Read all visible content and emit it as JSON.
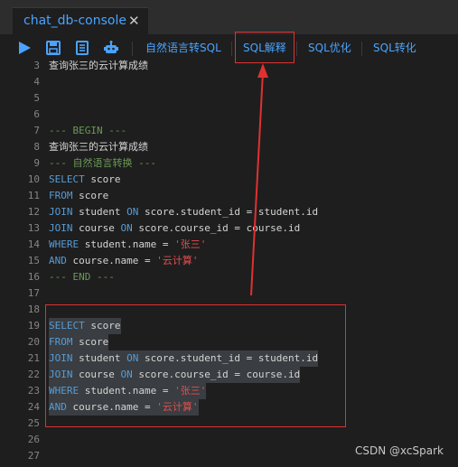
{
  "tab": {
    "title": "chat_db-console",
    "close": "✕"
  },
  "toolbar": {
    "nl_to_sql": "自然语言转SQL",
    "sql_explain": "SQL解释",
    "sql_optimize": "SQL优化",
    "sql_convert": "SQL转化"
  },
  "editor": {
    "lines": [
      {
        "n": "3",
        "t": "查询张三的云计算成绩"
      },
      {
        "n": "4",
        "t": ""
      },
      {
        "n": "5",
        "t": ""
      },
      {
        "n": "6",
        "t": ""
      },
      {
        "n": "7",
        "t": "--- BEGIN ---"
      },
      {
        "n": "8",
        "t": "查询张三的云计算成绩"
      },
      {
        "n": "9",
        "t": "--- 自然语言转换 ---"
      },
      {
        "n": "10",
        "t": "SELECT score"
      },
      {
        "n": "11",
        "t": "FROM score"
      },
      {
        "n": "12",
        "t": "JOIN student ON score.student_id = student.id"
      },
      {
        "n": "13",
        "t": "JOIN course ON score.course_id = course.id"
      },
      {
        "n": "14",
        "t": "WHERE student.name = '张三'"
      },
      {
        "n": "15",
        "t": "AND course.name = '云计算'"
      },
      {
        "n": "16",
        "t": "--- END ---"
      },
      {
        "n": "17",
        "t": ""
      },
      {
        "n": "18",
        "t": ""
      },
      {
        "n": "19",
        "t": "SELECT score"
      },
      {
        "n": "20",
        "t": "FROM score"
      },
      {
        "n": "21",
        "t": "JOIN student ON score.student_id = student.id"
      },
      {
        "n": "22",
        "t": "JOIN course ON score.course_id = course.id"
      },
      {
        "n": "23",
        "t": "WHERE student.name = '张三'"
      },
      {
        "n": "24",
        "t": "AND course.name = '云计算'"
      },
      {
        "n": "25",
        "t": ""
      },
      {
        "n": "26",
        "t": ""
      },
      {
        "n": "27",
        "t": ""
      }
    ]
  },
  "watermark": "CSDN @xcSpark",
  "colors": {
    "accent": "#4aa3ff",
    "highlight": "#e03131",
    "keyword": "#569cd6",
    "string": "#e05050",
    "comment": "#6a9955"
  }
}
